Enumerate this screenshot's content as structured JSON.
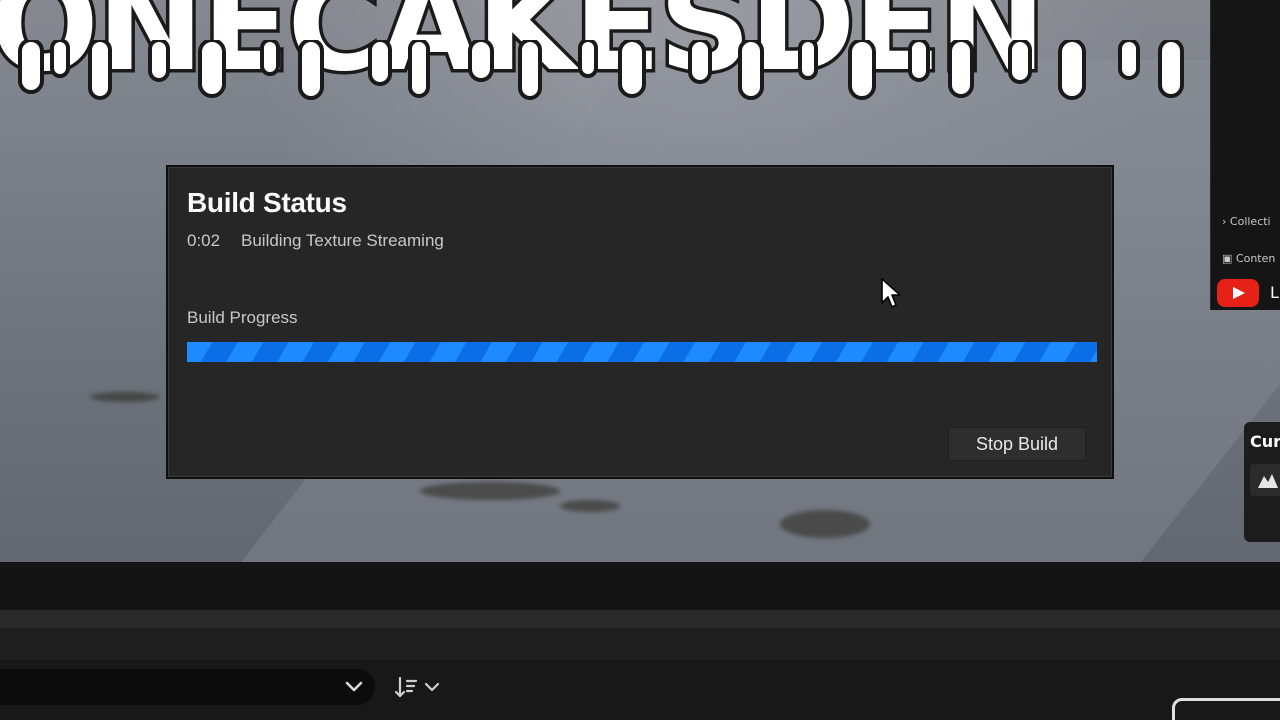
{
  "banner": {
    "text": "ONECAKESDEN"
  },
  "side_panel": {
    "tree_rows": [
      "Collecti",
      "Conten"
    ],
    "youtube_letter": "L",
    "curve_title": "Cur"
  },
  "dialog": {
    "title": "Build Status",
    "elapsed": "0:02",
    "current_task": "Building Texture Streaming",
    "progress_label": "Build Progress",
    "progress_fraction": 1.0,
    "stop_button": "Stop Build"
  },
  "colors": {
    "progress_blue": "#1d8bff",
    "dialog_bg": "#262626",
    "youtube_red": "#e62117"
  },
  "icons": {
    "cursor": "mouse-pointer-icon",
    "dropdown": "chevron-down-icon",
    "sort": "sort-icon",
    "youtube": "youtube-icon",
    "curve": "curve-icon"
  }
}
